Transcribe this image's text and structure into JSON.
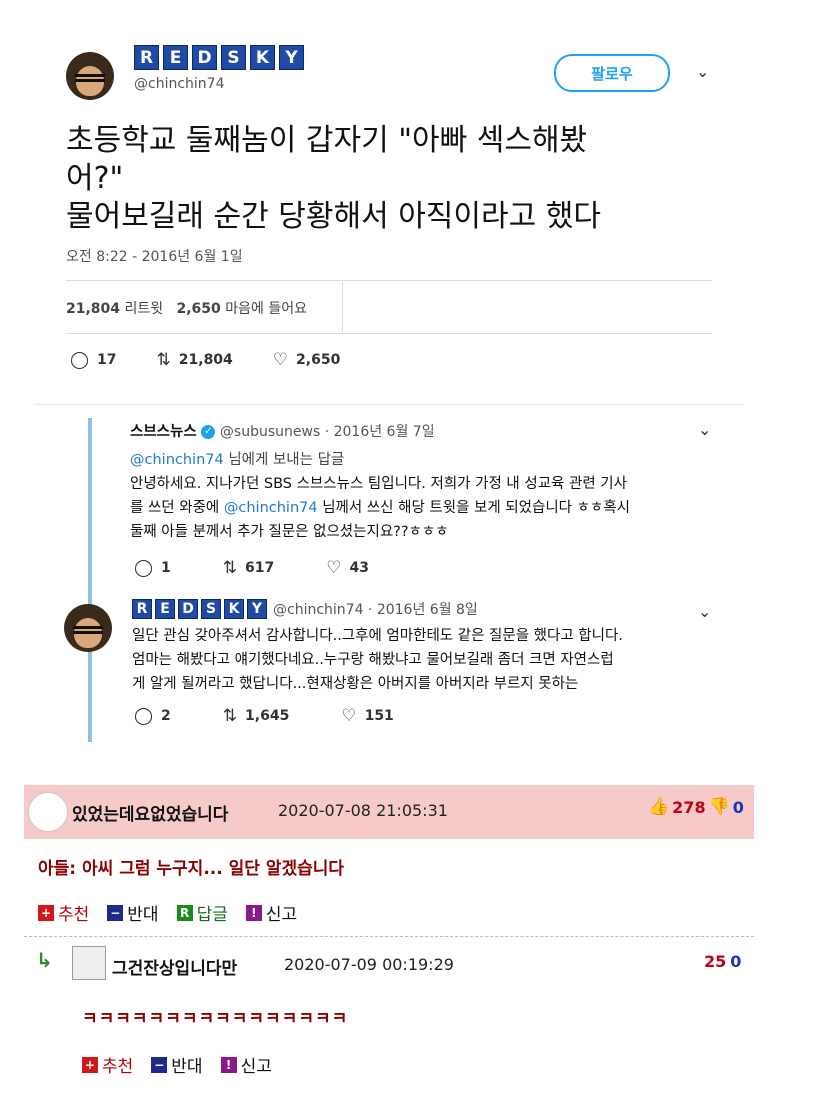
{
  "tweet": {
    "author_tiles": [
      "R",
      "E",
      "D",
      "S",
      "K",
      "Y"
    ],
    "handle": "@chinchin74",
    "follow_label": "팔로우",
    "text_line1": "초등학교 둘째놈이 갑자기  \"아빠  섹스해봤",
    "text_line2": "어?\"",
    "text_line3": "물어보길래 순간 당황해서  아직이라고 했다",
    "timestamp": "오전 8:22 - 2016년 6월 1일",
    "retweets_count": "21,804",
    "retweets_label": "리트윗",
    "likes_count": "2,650",
    "likes_label": "마음에 들어요",
    "actions": {
      "replies": "17",
      "retweets": "21,804",
      "likes": "2,650"
    }
  },
  "reply1": {
    "name": "스브스뉴스",
    "handle_date": "@subusunews · 2016년 6월 7일",
    "reply_to_handle": "@chinchin74",
    "reply_to_suffix": " 님에게 보내는 답글",
    "line1": "안녕하세요. 지나가던 SBS 스브스뉴스 팀입니다. 저희가 가정 내 성교육 관련 기사",
    "line2_pre": "를 쓰던 와중에 ",
    "line2_link": "@chinchin74",
    "line2_post": " 님께서 쓰신 해당 트윗을 보게 되었습니다 ㅎㅎ혹시",
    "line3": "둘째 아들 분께서 추가 질문은 없으셨는지요??ㅎㅎㅎ",
    "actions": {
      "replies": "1",
      "retweets": "617",
      "likes": "43"
    }
  },
  "reply2": {
    "tiles": [
      "R",
      "E",
      "D",
      "S",
      "K",
      "Y"
    ],
    "handle_date": "@chinchin74 · 2016년 6월 8일",
    "line1": "일단 관심 갖아주셔서 감사합니다..그후에 엄마한테도 같은 질문을 했다고 합니다.",
    "line2": "엄마는 해봤다고 얘기했다네요..누구랑 해봤냐고 물어보길래 좀더 크면 자연스럽",
    "line3": "게 알게 될꺼라고 했답니다...현재상황은 아버지를 아버지라 부르지 못하는",
    "actions": {
      "replies": "2",
      "retweets": "1,645",
      "likes": "151"
    }
  },
  "comment1": {
    "nick": "있었는데요없었습니다",
    "date": "2020-07-08 21:05:31",
    "up": "278",
    "down": "0",
    "body": "아들: 아씨 그럼 누구지... 일단 알겠습니다",
    "buttons": {
      "recommend": "추천",
      "oppose": "반대",
      "reply": "답글",
      "report": "신고"
    }
  },
  "comment2": {
    "nick": "그건잔상입니다만",
    "date": "2020-07-09 00:19:29",
    "up": "25",
    "down": "0",
    "body": "ㅋㅋㅋㅋㅋㅋㅋㅋㅋㅋㅋㅋㅋㅋㅋㅋ",
    "buttons": {
      "recommend": "추천",
      "oppose": "반대",
      "report": "신고"
    }
  },
  "colors": {
    "accent": "#1da1f2",
    "tile": "#1f4aa5",
    "comment_bg": "#f7caca",
    "comment_text": "#8b0000"
  }
}
